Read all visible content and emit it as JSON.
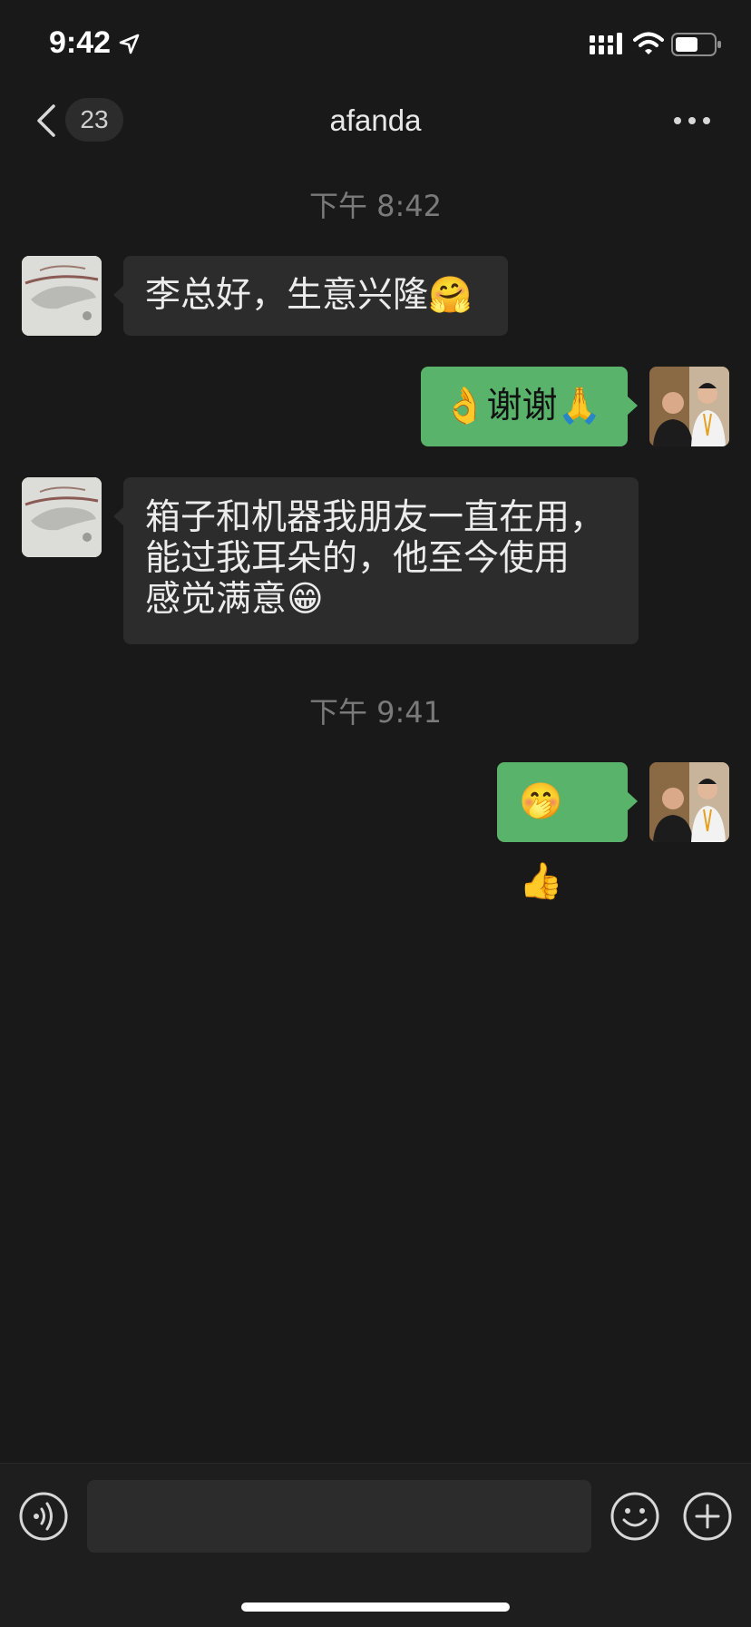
{
  "status_bar": {
    "time": "9:42",
    "icons": [
      "location-arrow-icon",
      "signal-icon",
      "wifi-icon",
      "battery-icon"
    ]
  },
  "nav": {
    "unread_count": "23",
    "title": "afanda",
    "icons": [
      "back-chevron-icon",
      "more-icon"
    ]
  },
  "messages": [
    {
      "type": "timestamp",
      "text": "下午 8:42"
    },
    {
      "type": "incoming",
      "text": "李总好，生意兴隆🤗"
    },
    {
      "type": "outgoing",
      "text": "👌谢谢🙏"
    },
    {
      "type": "incoming",
      "lines": [
        "箱子和机器我朋友一直在用，",
        "能过我耳朵的，他至今使用",
        "感觉满意😁"
      ]
    },
    {
      "type": "timestamp",
      "text": "下午 9:41"
    },
    {
      "type": "outgoing",
      "text": "🤭👍"
    }
  ],
  "input_bar": {
    "message_value": "",
    "icons": [
      "voice-icon",
      "emoji-icon",
      "plus-icon"
    ]
  },
  "colors": {
    "background": "#191919",
    "incoming_bubble": "#2c2c2c",
    "outgoing_bubble": "#59b36b",
    "timestamp_text": "#7a7a7a"
  }
}
